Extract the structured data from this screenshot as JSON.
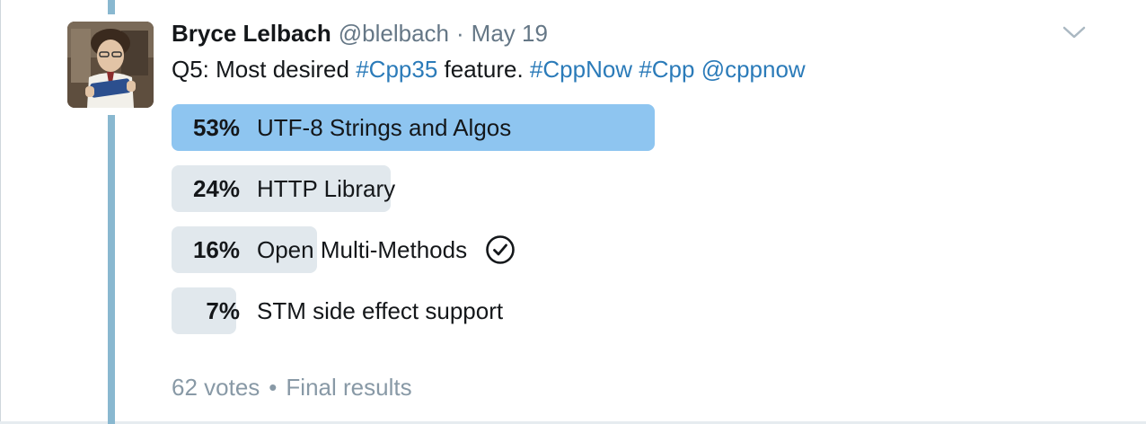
{
  "tweet": {
    "author": {
      "display_name": "Bryce Lelbach",
      "handle": "@blelbach"
    },
    "separator": "·",
    "date": "May 19",
    "text": {
      "prefix": "Q5: Most desired ",
      "hashtag_1": "#Cpp35",
      "middle": " feature. ",
      "hashtag_2": "#CppNow",
      "hashtag_3": "#Cpp",
      "mention": "@cppnow"
    },
    "icons": {
      "menu": "chevron-down-icon",
      "user_choice": "check-circle-icon"
    }
  },
  "poll": {
    "options": [
      {
        "percent_label": "53%",
        "percent": 53,
        "label": "UTF-8 Strings and Algos",
        "winner": true,
        "user_vote": false
      },
      {
        "percent_label": "24%",
        "percent": 24,
        "label": "HTTP Library",
        "winner": false,
        "user_vote": false
      },
      {
        "percent_label": "16%",
        "percent": 16,
        "label": "Open Multi-Methods",
        "winner": false,
        "user_vote": true
      },
      {
        "percent_label": "7%",
        "percent": 7,
        "label": "STM side effect support",
        "winner": false,
        "user_vote": false
      }
    ],
    "votes": "62 votes",
    "footer_separator": "•",
    "status": "Final results"
  },
  "colors": {
    "thread_line": "#89b8d0",
    "link": "#2b7bb9",
    "winner_bar": "#8ec5f0",
    "bar": "#e1e8ed",
    "muted_text": "#657786"
  }
}
